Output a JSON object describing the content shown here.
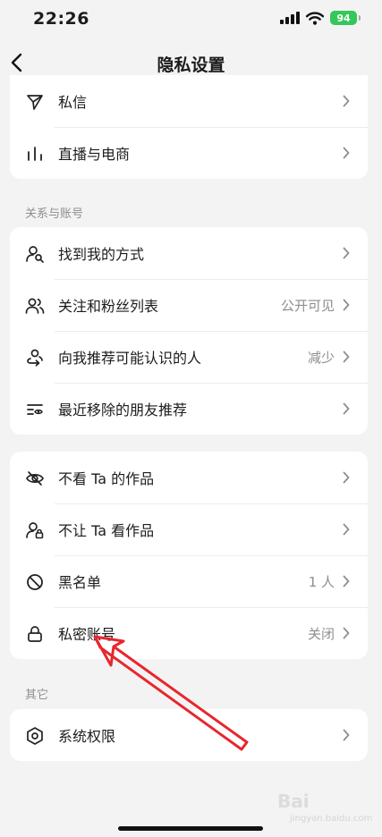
{
  "status": {
    "time": "22:26",
    "battery": "94"
  },
  "nav": {
    "title": "隐私设置"
  },
  "group1": [
    {
      "label": "私信",
      "value": ""
    },
    {
      "label": "直播与电商",
      "value": ""
    }
  ],
  "section2": "关系与账号",
  "group2": [
    {
      "label": "找到我的方式",
      "value": ""
    },
    {
      "label": "关注和粉丝列表",
      "value": "公开可见"
    },
    {
      "label": "向我推荐可能认识的人",
      "value": "减少"
    },
    {
      "label": "最近移除的朋友推荐",
      "value": ""
    }
  ],
  "group3": [
    {
      "label": "不看 Ta 的作品",
      "value": ""
    },
    {
      "label": "不让 Ta 看作品",
      "value": ""
    },
    {
      "label": "黑名单",
      "value": "1 人"
    },
    {
      "label": "私密账号",
      "value": "关闭"
    }
  ],
  "section4": "其它",
  "group4": [
    {
      "label": "系统权限",
      "value": ""
    }
  ],
  "watermark": {
    "brand": "Bai",
    "site": "jingyan.baidu.com"
  },
  "colors": {
    "annotation_arrow": "#e8262d",
    "battery": "#35c759"
  }
}
